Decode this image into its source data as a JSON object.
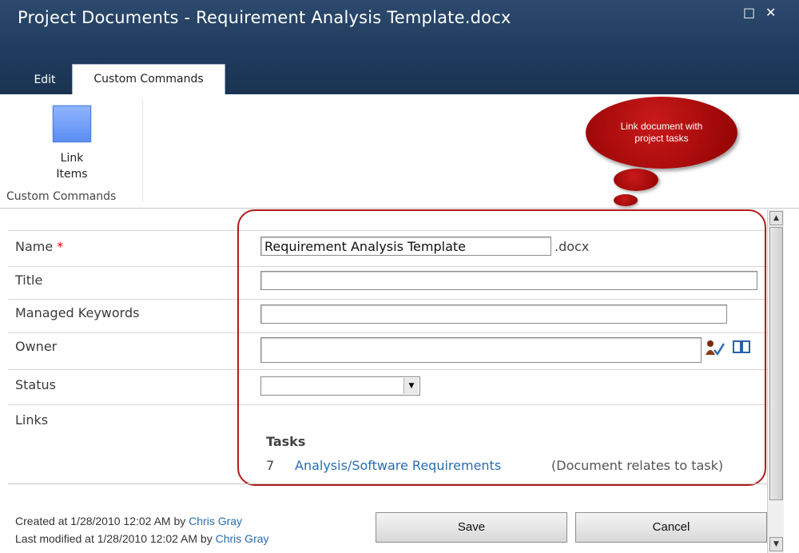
{
  "window": {
    "title": "Project Documents - Requirement Analysis Template.docx",
    "maximize_glyph": "□",
    "close_glyph": "✕"
  },
  "tabs": [
    {
      "label": "Edit"
    },
    {
      "label": "Custom Commands"
    }
  ],
  "ribbon": {
    "link_items_line1": "Link",
    "link_items_line2": "Items",
    "group_label": "Custom Commands"
  },
  "callout": {
    "text": "Link document with project tasks"
  },
  "form": {
    "name_label": "Name",
    "required_mark": "*",
    "name_value": "Requirement Analysis Template",
    "name_suffix": ".docx",
    "title_label": "Title",
    "title_value": "",
    "keywords_label": "Managed Keywords",
    "keywords_value": "",
    "owner_label": "Owner",
    "owner_value": "",
    "status_label": "Status",
    "status_value": "",
    "links_label": "Links",
    "tasks_heading": "Tasks",
    "task": {
      "number": "7",
      "link_text": "Analysis/Software Requirements",
      "note": "(Document relates to task)"
    }
  },
  "footer": {
    "created_prefix": "Created at 1/28/2010 12:02 AM by ",
    "created_by": "Chris Gray",
    "modified_prefix": "Last modified at 1/28/2010 12:02 AM by ",
    "modified_by": "Chris Gray"
  },
  "buttons": {
    "save": "Save",
    "cancel": "Cancel"
  },
  "colors": {
    "title_bar": "#1f3a5c",
    "callout_red": "#b31b1b",
    "link_blue": "#2a6db0"
  }
}
